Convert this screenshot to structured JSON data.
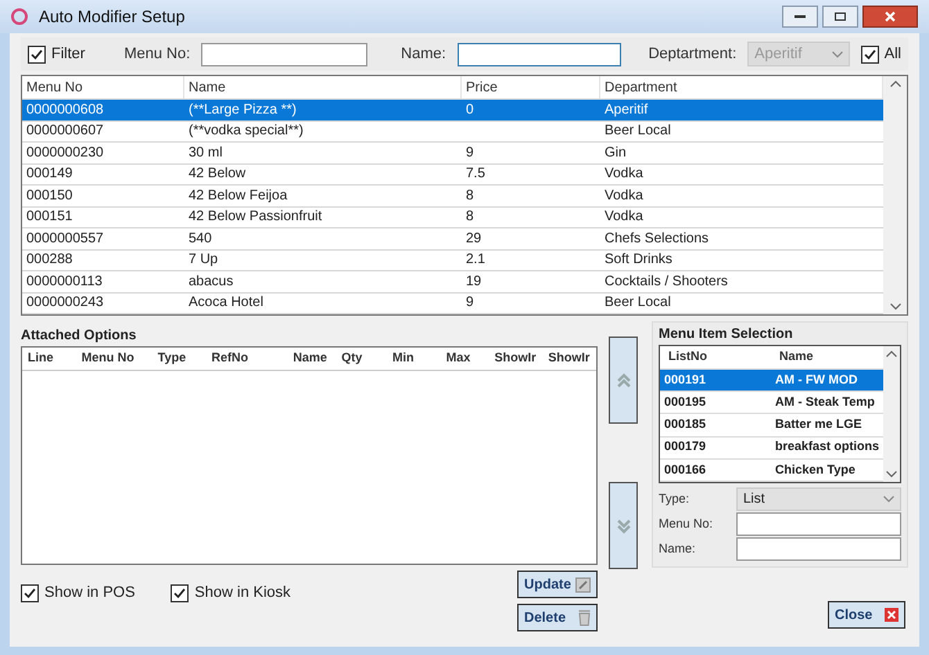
{
  "window": {
    "title": "Auto Modifier Setup"
  },
  "filter_bar": {
    "filter": {
      "label": "Filter",
      "checked": true
    },
    "menu_no": {
      "label": "Menu No:"
    },
    "name": {
      "label": "Name:"
    },
    "department": {
      "label": "Deptartment:",
      "value": "Aperitif",
      "disabled": true
    },
    "all": {
      "label": "All",
      "checked": true
    }
  },
  "items_table": {
    "columns": [
      "Menu No",
      "Name",
      "Price",
      "Department"
    ],
    "rows": [
      {
        "cells": [
          "0000000608",
          "(**Large Pizza **)",
          "0",
          "Aperitif"
        ],
        "selected": true
      },
      {
        "cells": [
          "0000000607",
          "(**vodka special**)",
          "",
          "Beer Local"
        ],
        "selected": false
      },
      {
        "cells": [
          "0000000230",
          "30 ml",
          "9",
          "Gin"
        ],
        "selected": false
      },
      {
        "cells": [
          "000149",
          "42 Below",
          "7.5",
          "Vodka"
        ],
        "selected": false
      },
      {
        "cells": [
          "000150",
          "42 Below Feijoa",
          "8",
          "Vodka"
        ],
        "selected": false
      },
      {
        "cells": [
          "000151",
          "42 Below Passionfruit",
          "8",
          "Vodka"
        ],
        "selected": false
      },
      {
        "cells": [
          "0000000557",
          "540",
          "29",
          "Chefs Selections"
        ],
        "selected": false
      },
      {
        "cells": [
          "000288",
          "7 Up",
          "2.1",
          "Soft Drinks"
        ],
        "selected": false
      },
      {
        "cells": [
          "0000000113",
          "abacus",
          "19",
          "Cocktails / Shooters"
        ],
        "selected": false
      },
      {
        "cells": [
          "0000000243",
          "Acoca Hotel",
          "9",
          "Beer Local"
        ],
        "selected": false
      }
    ]
  },
  "attached_options": {
    "title": "Attached Options",
    "columns": [
      "Line",
      "Menu No",
      "Type",
      "RefNo",
      "Name",
      "Qty",
      "Min",
      "Max",
      "ShowIr",
      "ShowIr"
    ]
  },
  "options": [
    {
      "label": "Show in POS",
      "checked": true
    },
    {
      "label": "Show in Kiosk",
      "checked": true
    }
  ],
  "menu_item_selection": {
    "title": "Menu Item Selection",
    "columns": [
      "ListNo",
      "Name"
    ],
    "rows": [
      {
        "cells": [
          "000191",
          "AM - FW MOD"
        ],
        "selected": true
      },
      {
        "cells": [
          "000195",
          "AM - Steak Temp"
        ],
        "selected": false
      },
      {
        "cells": [
          "000185",
          "Batter me LGE"
        ],
        "selected": false
      },
      {
        "cells": [
          "000179",
          "breakfast options"
        ],
        "selected": false
      },
      {
        "cells": [
          "000166",
          "Chicken Type"
        ],
        "selected": false
      }
    ],
    "type": {
      "label": "Type:",
      "value": "List"
    },
    "menu_no": {
      "label": "Menu No:"
    },
    "name": {
      "label": "Name:"
    }
  },
  "buttons": {
    "update": "Update",
    "delete": "Delete",
    "close": "Close"
  }
}
